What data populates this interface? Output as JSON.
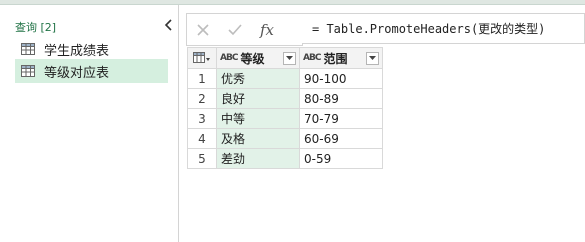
{
  "queries_pane": {
    "header": "查询 [2]",
    "items": [
      {
        "label": "学生成绩表",
        "selected": false
      },
      {
        "label": "等级对应表",
        "selected": true
      }
    ]
  },
  "formula_bar": {
    "cancel_icon": "cancel-x-icon",
    "commit_icon": "checkmark-icon",
    "fx_label": "fx",
    "formula": "= Table.PromoteHeaders(更改的类型)"
  },
  "table": {
    "columns": [
      {
        "name": "等级",
        "type_icon": "ABC"
      },
      {
        "name": "范围",
        "type_icon": "ABC"
      }
    ],
    "rows": [
      {
        "num": "1",
        "grade": "优秀",
        "range": "90-100"
      },
      {
        "num": "2",
        "grade": "良好",
        "range": "80-89"
      },
      {
        "num": "3",
        "grade": "中等",
        "range": "70-79"
      },
      {
        "num": "4",
        "grade": "及格",
        "range": "60-69"
      },
      {
        "num": "5",
        "grade": "差劲",
        "range": "0-59"
      }
    ]
  },
  "colors": {
    "accent_green": "#217346",
    "selected_bg": "#d5efdf",
    "column_highlight": "#e2f2e8"
  }
}
